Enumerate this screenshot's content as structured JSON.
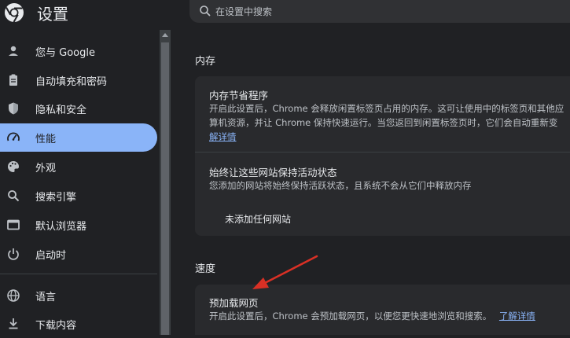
{
  "header": {
    "title": "设置",
    "search_placeholder": "在设置中搜索"
  },
  "sidebar": {
    "items": [
      {
        "label": "您与 Google",
        "icon": "person-icon",
        "active": false
      },
      {
        "label": "自动填充和密码",
        "icon": "clipboard-icon",
        "active": false
      },
      {
        "label": "隐私和安全",
        "icon": "shield-icon",
        "active": false
      },
      {
        "label": "性能",
        "icon": "speedometer-icon",
        "active": true
      },
      {
        "label": "外观",
        "icon": "palette-icon",
        "active": false
      },
      {
        "label": "搜索引擎",
        "icon": "search-icon",
        "active": false
      },
      {
        "label": "默认浏览器",
        "icon": "browser-window-icon",
        "active": false
      },
      {
        "label": "启动时",
        "icon": "power-icon",
        "active": false
      },
      {
        "label": "语言",
        "icon": "globe-icon",
        "active": false
      },
      {
        "label": "下载内容",
        "icon": "download-icon",
        "active": false
      }
    ]
  },
  "memory": {
    "heading": "内存",
    "saver_title": "内存节省程序",
    "saver_desc_line1": "开启此设置后，Chrome 会释放闲置标签页占用的内存。这可让使用中的标签页和其他应",
    "saver_desc_line2": "算机资源，并让 Chrome 保持快速运行。当您返回到闲置标签页时，它们会自动重新变",
    "saver_learn_more": "解详情",
    "keep_active_title": "始终让这些网站保持活动状态",
    "keep_active_desc": "您添加的网站将始终保持活跃状态，且系统不会从它们中释放内存",
    "no_sites": "未添加任何网站"
  },
  "speed": {
    "heading": "速度",
    "preload_title": "预加载网页",
    "preload_desc": "开启此设置后，Chrome 会预加载网页，以便您更快速地浏览和搜索。",
    "preload_learn_more": "了解详情"
  },
  "colors": {
    "accent": "#8ab4f8",
    "background": "#202124",
    "card": "#292a2d",
    "annotation_arrow": "#d93025"
  }
}
